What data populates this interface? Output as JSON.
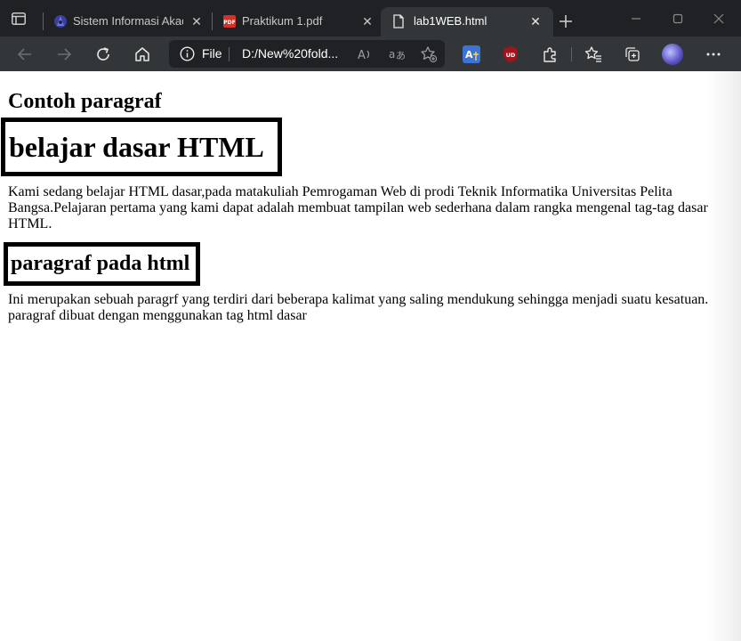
{
  "browser": {
    "tabs": [
      {
        "title": "Sistem Informasi Akade",
        "favicon": "university-logo-icon",
        "active": false
      },
      {
        "title": "Praktikum 1.pdf",
        "favicon": "pdf-icon",
        "active": false
      },
      {
        "title": "lab1WEB.html",
        "favicon": "document-icon",
        "active": true
      }
    ],
    "address": {
      "scheme_label": "File",
      "url": "D:/New%20fold..."
    },
    "colors": {
      "titlebar": "#202124",
      "toolbar": "#323639",
      "omnibox": "#202124"
    }
  },
  "page": {
    "heading": "Contoh paragraf",
    "box_heading_1": "belajar dasar HTML",
    "paragraph_1": "Kami sedang belajar HTML dasar,pada matakuliah Pemrogaman Web di prodi Teknik Informatika Universitas Pelita Bangsa.Pelajaran pertama yang kami dapat adalah membuat tampilan web sederhana dalam rangka mengenal tag-tag dasar HTML.",
    "box_heading_2": "paragraf pada html",
    "paragraph_2": "Ini merupakan sebuah paragrf yang terdiri dari beberapa kalimat yang saling mendukung sehingga menjadi suatu kesatuan. paragraf dibuat dengan menggunakan tag html dasar"
  }
}
